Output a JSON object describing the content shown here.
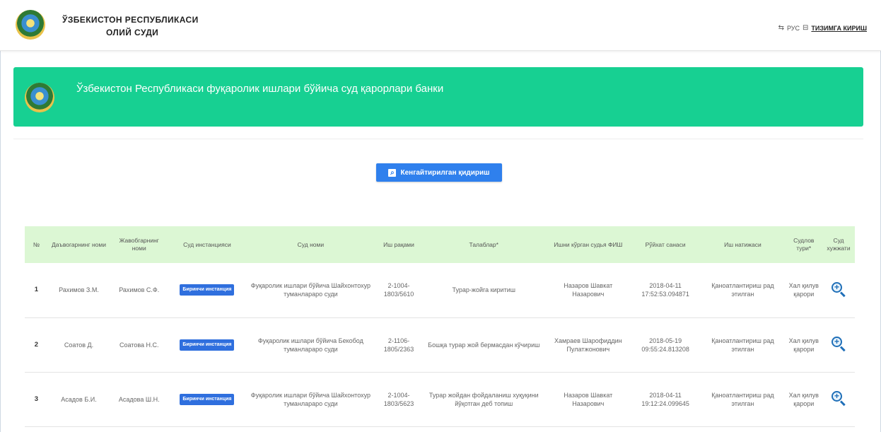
{
  "header": {
    "title_line1": "ЎЗБЕКИСТОН РЕСПУБЛИКАСИ",
    "title_line2": "ОЛИЙ СУДИ",
    "lang_icon": "swap-icon",
    "lang_label": "РУС",
    "login_icon": "login-icon",
    "login_label": "ТИЗИМГА КИРИШ"
  },
  "banner": {
    "text": "Ўзбекистон Республикаси фуқаролик ишлари бўйича суд қарорлари банки"
  },
  "search": {
    "label": "Кенгайтирилган қидириш",
    "icon": "search-doc-icon"
  },
  "colors": {
    "banner": "#17d092",
    "button": "#2f80ed",
    "table_header": "#dcf7d4",
    "badge": "#2f6fde"
  },
  "table": {
    "headers": [
      "№",
      "Даъвогарнинг номи",
      "Жавобгарнинг номи",
      "Суд инстанцияси",
      "Суд номи",
      "Иш рақами",
      "Талаблар*",
      "Ишни кўрган судья ФИШ",
      "Рўйхат санаси",
      "Иш натижаси",
      "Судлов тури*",
      "Суд хужжати"
    ],
    "rows": [
      {
        "num": "1",
        "plaintiff": "Рахимов З.М.",
        "defendant": "Рахимов С.Ф.",
        "instance": "Биринчи инстанция",
        "court": "Фуқаролик ишлари бўйича Шайхонтохур туманлараро суди",
        "case_no": "2-1004-1803/5610",
        "claim": "Турар-жойга киритиш",
        "judge": "Назаров Шавкат Назарович",
        "date": "2018-04-11 17:52:53.094871",
        "result": "Қаноатлантириш рад этилган",
        "type": "Хал қилув қарори",
        "doc_icon": "magnifier-plus-icon"
      },
      {
        "num": "2",
        "plaintiff": "Соатов Д.",
        "defendant": "Соатова Н.С.",
        "instance": "Биринчи инстанция",
        "court": "Фуқаролик ишлари бўйича Бекобод туманлараро суди",
        "case_no": "2-1106-1805/2363",
        "claim": "Бошқа турар жой бермасдан кўчириш",
        "judge": "Хамраев Шарофиддин Пулатжонович",
        "date": "2018-05-19 09:55:24.813208",
        "result": "Қаноатлантириш рад этилган",
        "type": "Хал қилув қарори",
        "doc_icon": "magnifier-plus-icon"
      },
      {
        "num": "3",
        "plaintiff": "Асадов Б.И.",
        "defendant": "Асадова Ш.Н.",
        "instance": "Биринчи инстанция",
        "court": "Фуқаролик ишлари бўйича Шайхонтохур туманлараро суди",
        "case_no": "2-1004-1803/5623",
        "claim": "Турар жойдан фойдаланиш хуқуқини йўқотган деб топиш",
        "judge": "Назаров Шавкат Назарович",
        "date": "2018-04-11 19:12:24.099645",
        "result": "Қаноатлантириш рад этилган",
        "type": "Хал қилув қарори",
        "doc_icon": "magnifier-plus-icon"
      }
    ]
  }
}
